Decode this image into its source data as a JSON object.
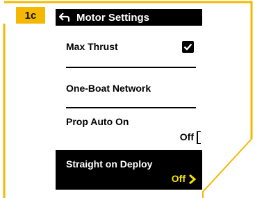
{
  "step": "1c",
  "screen": {
    "title": "Motor Settings",
    "back_icon": "back-arrow-icon",
    "rows": [
      {
        "label": "Max Thrust",
        "control": "checkbox",
        "checked": true
      },
      {
        "label": "One-Boat Network"
      },
      {
        "label": "Prop Auto On",
        "value": "Off"
      },
      {
        "label": "Straight on Deploy",
        "value": "Off",
        "selected": true,
        "accent": "#f2e300"
      }
    ]
  },
  "colors": {
    "badge": "#f5b800",
    "frame_line": "#f5b800",
    "screen_bg": "#ffffff",
    "selection_bg": "#000000",
    "accent": "#f2e300"
  }
}
